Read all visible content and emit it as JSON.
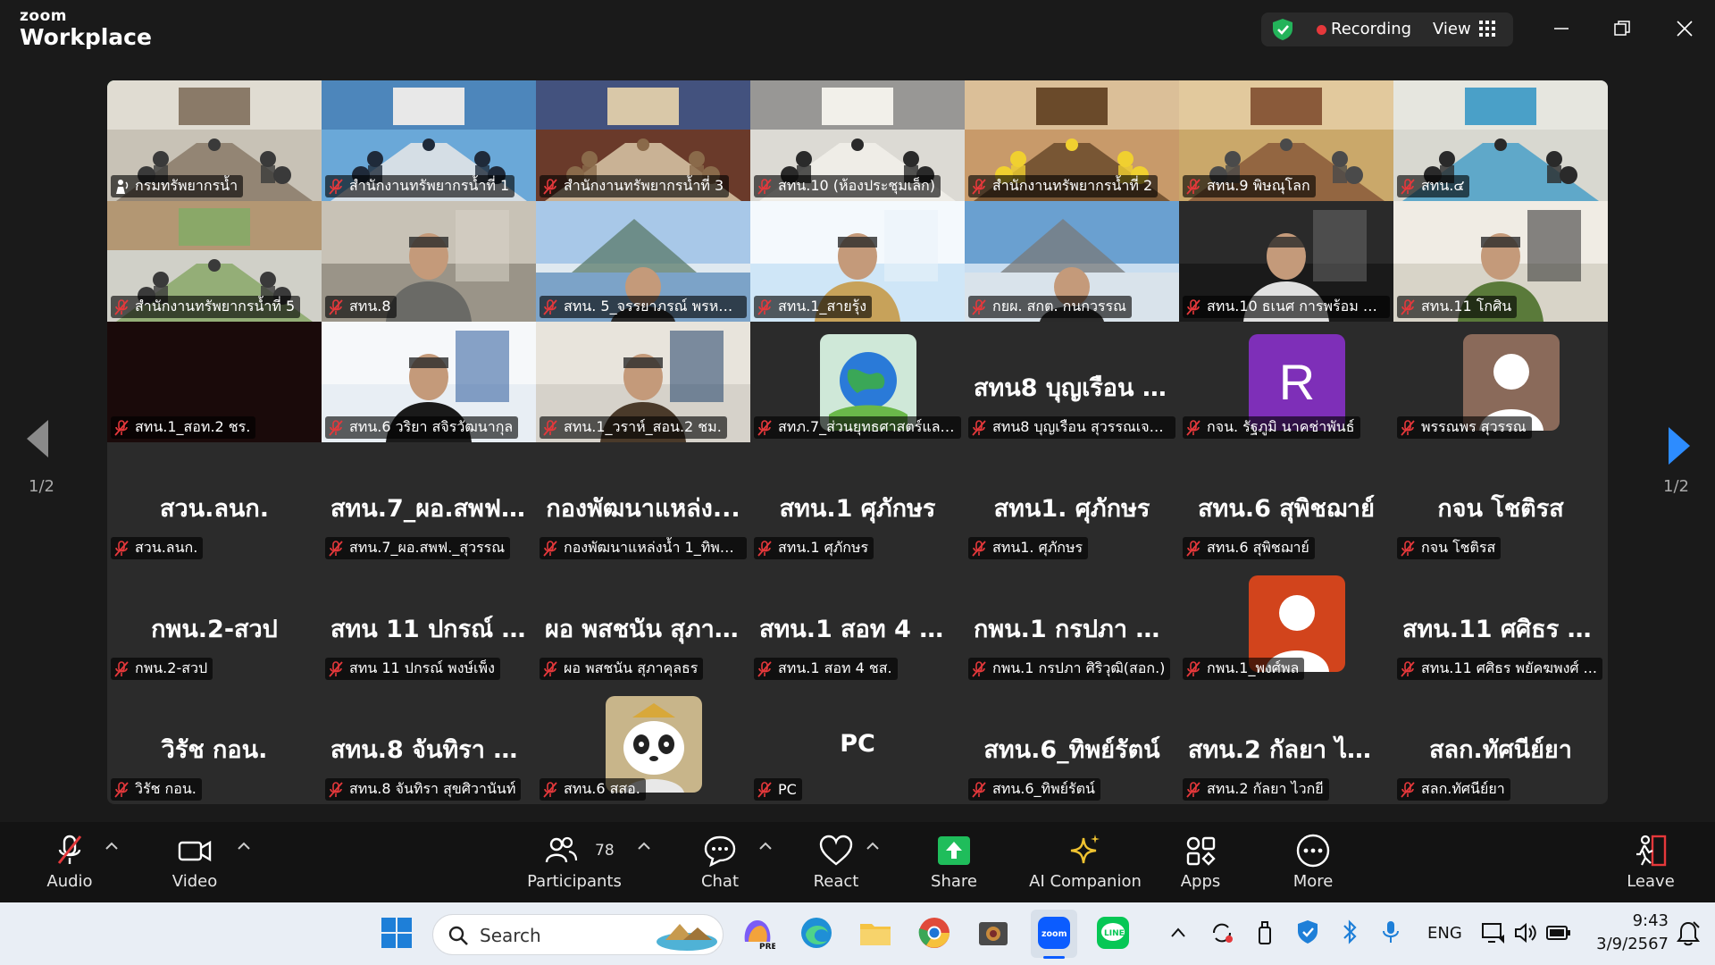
{
  "app": {
    "brand_small": "zoom",
    "brand_big": "Workplace"
  },
  "topbar": {
    "recording_label": "Recording",
    "view_label": "View"
  },
  "pager": {
    "left_label": "1/2",
    "right_label": "1/2"
  },
  "tiles": [
    {
      "name": "กรมทรัพยากรน้ำ",
      "type": "video",
      "scene": "conf-a",
      "active": true,
      "muted": false
    },
    {
      "name": "สำนักงานทรัพยากรน้ำที่ 1",
      "type": "video",
      "scene": "conf-b",
      "muted": true
    },
    {
      "name": "สำนักงานทรัพยากรน้ำที่ 3",
      "type": "video",
      "scene": "conf-c",
      "muted": true
    },
    {
      "name": "สทน.10 (ห้องประชุมเล็ก)",
      "type": "video",
      "scene": "conf-d",
      "muted": true
    },
    {
      "name": "สำนักงานทรัพยากรน้ำที่ 2",
      "type": "video",
      "scene": "conf-e",
      "muted": true
    },
    {
      "name": "สทน.9 พิษณุโลก",
      "type": "video",
      "scene": "conf-f",
      "muted": true
    },
    {
      "name": "สทน.๔",
      "type": "video",
      "scene": "conf-g",
      "muted": true
    },
    {
      "name": "สำนักงานทรัพยากรน้ำที่ 5",
      "type": "video",
      "scene": "conf-h",
      "muted": true
    },
    {
      "name": "สทน.8",
      "type": "video",
      "scene": "office",
      "muted": true
    },
    {
      "name": "สทน. 5_จรรยาภรณ์ พรหม...",
      "type": "video",
      "scene": "river",
      "muted": true
    },
    {
      "name": "สทน.1_สายรุ้ง",
      "type": "video",
      "scene": "bright",
      "muted": true
    },
    {
      "name": "กยผ. สกต. กนกวรรณ",
      "type": "video",
      "scene": "louvre",
      "muted": true
    },
    {
      "name": "สทน.10 ธเนศ การพร้อม ส...",
      "type": "video",
      "scene": "dark-man",
      "muted": true
    },
    {
      "name": "สทน.11 โกศิน",
      "type": "video",
      "scene": "man-suit",
      "muted": true
    },
    {
      "name": "สทน.1_สอท.2 ชร.",
      "type": "video",
      "scene": "black",
      "muted": true
    },
    {
      "name": "สทน.6 วริยา สจิรวัฒนากุล",
      "type": "video",
      "scene": "woman",
      "muted": true
    },
    {
      "name": "สทน.1_วราห์_สอน.2 ชม.",
      "type": "video",
      "scene": "man-glasses",
      "muted": true
    },
    {
      "name": "สทภ.7_ส่วนยุทธศาสตร์และ...",
      "type": "avatar",
      "avatar": "earth",
      "muted": true
    },
    {
      "name": "สทน8 บุญเรือน สุวรรณเจริ...",
      "type": "text",
      "display": "สทน8 บุญเรือน สุ...",
      "muted": true
    },
    {
      "name": "กจน. รัฐภูมิ นาคช่าพันธ์",
      "type": "avatar",
      "avatar": "letter",
      "letter": "R",
      "muted": true
    },
    {
      "name": "พรรณพร สุวรรณ",
      "type": "avatar",
      "avatar": "person-brown",
      "muted": true
    },
    {
      "name": "สวน.ลนก.",
      "type": "text",
      "display": "สวน.ลนก.",
      "muted": true
    },
    {
      "name": "สทน.7_ผอ.สพฟ._สุวรรณ",
      "type": "text",
      "display": "สทน.7_ผอ.สพฟ._...",
      "muted": true
    },
    {
      "name": "กองพัฒนาแหล่งน้ำ 1_ทิพว...",
      "type": "text",
      "display": "กองพัฒนาแหล่ง...",
      "muted": true
    },
    {
      "name": "สทน.1 ศุภักษร",
      "type": "text",
      "display": "สทน.1 ศุภักษร",
      "muted": true
    },
    {
      "name": "สทน1. ศุภักษร",
      "type": "text",
      "display": "สทน1. ศุภักษร",
      "muted": true
    },
    {
      "name": "สทน.6 สุพิชฌาย์",
      "type": "text",
      "display": "สทน.6 สุพิชฌาย์",
      "muted": true
    },
    {
      "name": "กจน โชติรส",
      "type": "text",
      "display": "กจน โชติรส",
      "muted": true
    },
    {
      "name": "กพน.2-สวป",
      "type": "text",
      "display": "กพน.2-สวป",
      "muted": true
    },
    {
      "name": "สทน 11 ปกรณ์ พงษ์เพ็ง",
      "type": "text",
      "display": "สทน 11 ปกรณ์ พ...",
      "muted": true
    },
    {
      "name": "ผอ พสชนัน สุภาคุลธร",
      "type": "text",
      "display": "ผอ พสชนัน สุภา...",
      "muted": true
    },
    {
      "name": "สทน.1 สอท 4 ชส.",
      "type": "text",
      "display": "สทน.1 สอท 4 ชส.",
      "muted": true
    },
    {
      "name": "กพน.1 กรปภา ศิริวุฒิ(สอก.)",
      "type": "text",
      "display": "กพน.1 กรปภา ศิ...",
      "muted": true
    },
    {
      "name": "กพน.1_พงศ์พล",
      "type": "avatar",
      "avatar": "person-orange",
      "muted": true
    },
    {
      "name": "สทน.11 ศศิธร พยัคฆพงศ์ ...",
      "type": "text",
      "display": "สทน.11 ศศิธร พ...",
      "muted": true
    },
    {
      "name": "วิรัช กอน.",
      "type": "text",
      "display": "วิรัช กอน.",
      "muted": true
    },
    {
      "name": "สทน.8 จันทิรา สุขศิวานันท์",
      "type": "text",
      "display": "สทน.8 จันทิรา สุ...",
      "muted": true
    },
    {
      "name": "สทน.6 สสอ.",
      "type": "avatar",
      "avatar": "panda",
      "muted": true
    },
    {
      "name": "PC",
      "type": "text",
      "display": "PC",
      "muted": true
    },
    {
      "name": "สทน.6_ทิพย์รัตน์",
      "type": "text",
      "display": "สทน.6_ทิพย์รัตน์",
      "muted": true
    },
    {
      "name": "สทน.2 กัลยา ไวกยี",
      "type": "text",
      "display": "สทน.2 กัลยา ไวกยี",
      "muted": true
    },
    {
      "name": "สลก.ทัศนีย์ยา",
      "type": "text",
      "display": "สลก.ทัศนีย์ยา",
      "muted": true
    }
  ],
  "toolbar": {
    "audio": "Audio",
    "video": "Video",
    "participants": "Participants",
    "participants_count": "78",
    "chat": "Chat",
    "react": "React",
    "share": "Share",
    "ai": "AI Companion",
    "apps": "Apps",
    "more": "More",
    "leave": "Leave"
  },
  "taskbar": {
    "search_label": "Search",
    "lang": "ENG",
    "time": "9:43",
    "date": "3/9/2567"
  },
  "colors": {
    "active_speaker": "#23d977",
    "leave": "#e5383b",
    "share": "#1fbd5b",
    "mute": "#e5383b"
  }
}
